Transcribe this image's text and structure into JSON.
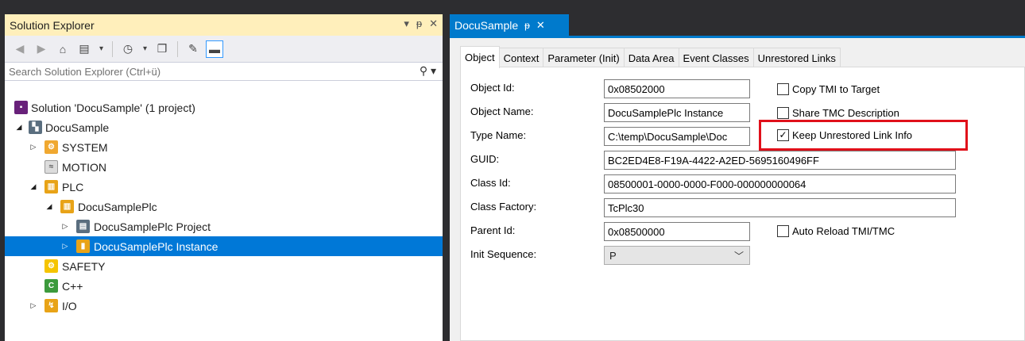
{
  "solution_explorer": {
    "title": "Solution Explorer",
    "title_controls": [
      "▾",
      "ᵽ",
      "✕"
    ],
    "search_placeholder": "Search Solution Explorer (Ctrl+ü)",
    "tree": [
      {
        "label": "Solution 'DocuSample' (1 project)",
        "icon": "solution-icon"
      },
      {
        "label": "DocuSample",
        "icon": "twincat-project-icon"
      },
      {
        "label": "SYSTEM",
        "icon": "system-gear-icon"
      },
      {
        "label": "MOTION",
        "icon": "motion-icon"
      },
      {
        "label": "PLC",
        "icon": "plc-icon"
      },
      {
        "label": "DocuSamplePlc",
        "icon": "plc-project-icon"
      },
      {
        "label": "DocuSamplePlc Project",
        "icon": "plc-subproject-icon"
      },
      {
        "label": "DocuSamplePlc Instance",
        "icon": "plc-instance-icon"
      },
      {
        "label": "SAFETY",
        "icon": "safety-icon"
      },
      {
        "label": "C++",
        "icon": "cpp-icon"
      },
      {
        "label": "I/O",
        "icon": "io-icon"
      }
    ]
  },
  "editor": {
    "doc_tab": "DocuSample",
    "tabs": [
      "Object",
      "Context",
      "Parameter (Init)",
      "Data Area",
      "Event Classes",
      "Unrestored Links"
    ],
    "fields": {
      "object_id": {
        "label": "Object Id:",
        "value": "0x08502000"
      },
      "object_name": {
        "label": "Object Name:",
        "value": "DocuSamplePlc Instance"
      },
      "type_name": {
        "label": "Type Name:",
        "value": "C:\\temp\\DocuSample\\Doc"
      },
      "guid": {
        "label": "GUID:",
        "value": "BC2ED4E8-F19A-4422-A2ED-5695160496FF"
      },
      "class_id": {
        "label": "Class Id:",
        "value": "08500001-0000-0000-F000-000000000064"
      },
      "class_factory": {
        "label": "Class Factory:",
        "value": "TcPlc30"
      },
      "parent_id": {
        "label": "Parent Id:",
        "value": "0x08500000"
      },
      "init_sequence": {
        "label": "Init Sequence:",
        "value": "P"
      }
    },
    "checkboxes": {
      "copy_tmi": {
        "label": "Copy TMI to Target",
        "checked": false
      },
      "share_tmc": {
        "label": "Share TMC Description",
        "checked": false
      },
      "keep_unrestored": {
        "label": "Keep Unrestored Link Info",
        "checked": true
      },
      "auto_reload": {
        "label": "Auto Reload TMI/TMC",
        "checked": false
      }
    }
  },
  "colors": {
    "accent": "#007acc",
    "selection": "#0078d7",
    "highlight": "#e0101a",
    "title_bar": "#ffefbb"
  }
}
